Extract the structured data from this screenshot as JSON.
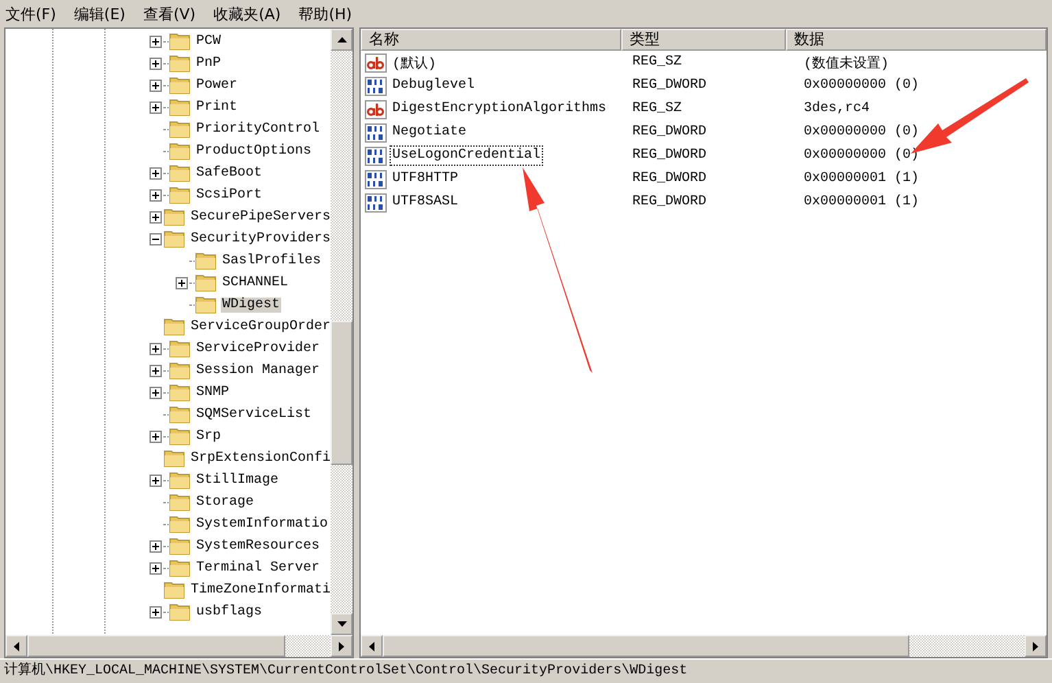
{
  "menu": [
    "文件(F)",
    "编辑(E)",
    "查看(V)",
    "收藏夹(A)",
    "帮助(H)"
  ],
  "tree": [
    {
      "label": "PCW",
      "kind": "collapsed",
      "selected": false
    },
    {
      "label": "PnP",
      "kind": "collapsed",
      "selected": false
    },
    {
      "label": "Power",
      "kind": "collapsed",
      "selected": false
    },
    {
      "label": "Print",
      "kind": "collapsed",
      "selected": false
    },
    {
      "label": "PriorityControl",
      "kind": "leaf",
      "selected": false
    },
    {
      "label": "ProductOptions",
      "kind": "leaf",
      "selected": false
    },
    {
      "label": "SafeBoot",
      "kind": "collapsed",
      "selected": false
    },
    {
      "label": "ScsiPort",
      "kind": "collapsed",
      "selected": false
    },
    {
      "label": "SecurePipeServers",
      "kind": "collapsed",
      "selected": false
    },
    {
      "label": "SecurityProviders",
      "kind": "expanded",
      "selected": false,
      "children": [
        {
          "label": "SaslProfiles",
          "kind": "leaf",
          "selected": false
        },
        {
          "label": "SCHANNEL",
          "kind": "collapsed",
          "selected": false
        },
        {
          "label": "WDigest",
          "kind": "leaf",
          "selected": true
        }
      ]
    },
    {
      "label": "ServiceGroupOrder",
      "kind": "leaf",
      "selected": false
    },
    {
      "label": "ServiceProvider",
      "kind": "collapsed",
      "selected": false
    },
    {
      "label": "Session Manager",
      "kind": "collapsed",
      "selected": false
    },
    {
      "label": "SNMP",
      "kind": "collapsed",
      "selected": false
    },
    {
      "label": "SQMServiceList",
      "kind": "leaf",
      "selected": false
    },
    {
      "label": "Srp",
      "kind": "collapsed",
      "selected": false
    },
    {
      "label": "SrpExtensionConfi",
      "kind": "leaf",
      "selected": false
    },
    {
      "label": "StillImage",
      "kind": "collapsed",
      "selected": false
    },
    {
      "label": "Storage",
      "kind": "leaf",
      "selected": false
    },
    {
      "label": "SystemInformatio",
      "kind": "leaf",
      "selected": false
    },
    {
      "label": "SystemResources",
      "kind": "collapsed",
      "selected": false
    },
    {
      "label": "Terminal Server",
      "kind": "collapsed",
      "selected": false
    },
    {
      "label": "TimeZoneInformati",
      "kind": "leaf",
      "selected": false
    },
    {
      "label": "usbflags",
      "kind": "collapsed",
      "selected": false
    }
  ],
  "table": {
    "columns": [
      "名称",
      "类型",
      "数据"
    ],
    "rows": [
      {
        "kind": "sz",
        "name": "(默认)",
        "type": "REG_SZ",
        "data": "(数值未设置)",
        "focused": false
      },
      {
        "kind": "dword",
        "name": "Debuglevel",
        "type": "REG_DWORD",
        "data": "0x00000000 (0)",
        "focused": false
      },
      {
        "kind": "sz",
        "name": "DigestEncryptionAlgorithms",
        "type": "REG_SZ",
        "data": "3des,rc4",
        "focused": false
      },
      {
        "kind": "dword",
        "name": "Negotiate",
        "type": "REG_DWORD",
        "data": "0x00000000 (0)",
        "focused": false
      },
      {
        "kind": "dword",
        "name": "UseLogonCredential",
        "type": "REG_DWORD",
        "data": "0x00000000 (0)",
        "focused": true
      },
      {
        "kind": "dword",
        "name": "UTF8HTTP",
        "type": "REG_DWORD",
        "data": "0x00000001 (1)",
        "focused": false
      },
      {
        "kind": "dword",
        "name": "UTF8SASL",
        "type": "REG_DWORD",
        "data": "0x00000001 (1)",
        "focused": false
      }
    ]
  },
  "status_bar": "计算机\\HKEY_LOCAL_MACHINE\\SYSTEM\\CurrentControlSet\\Control\\SecurityProviders\\WDigest"
}
